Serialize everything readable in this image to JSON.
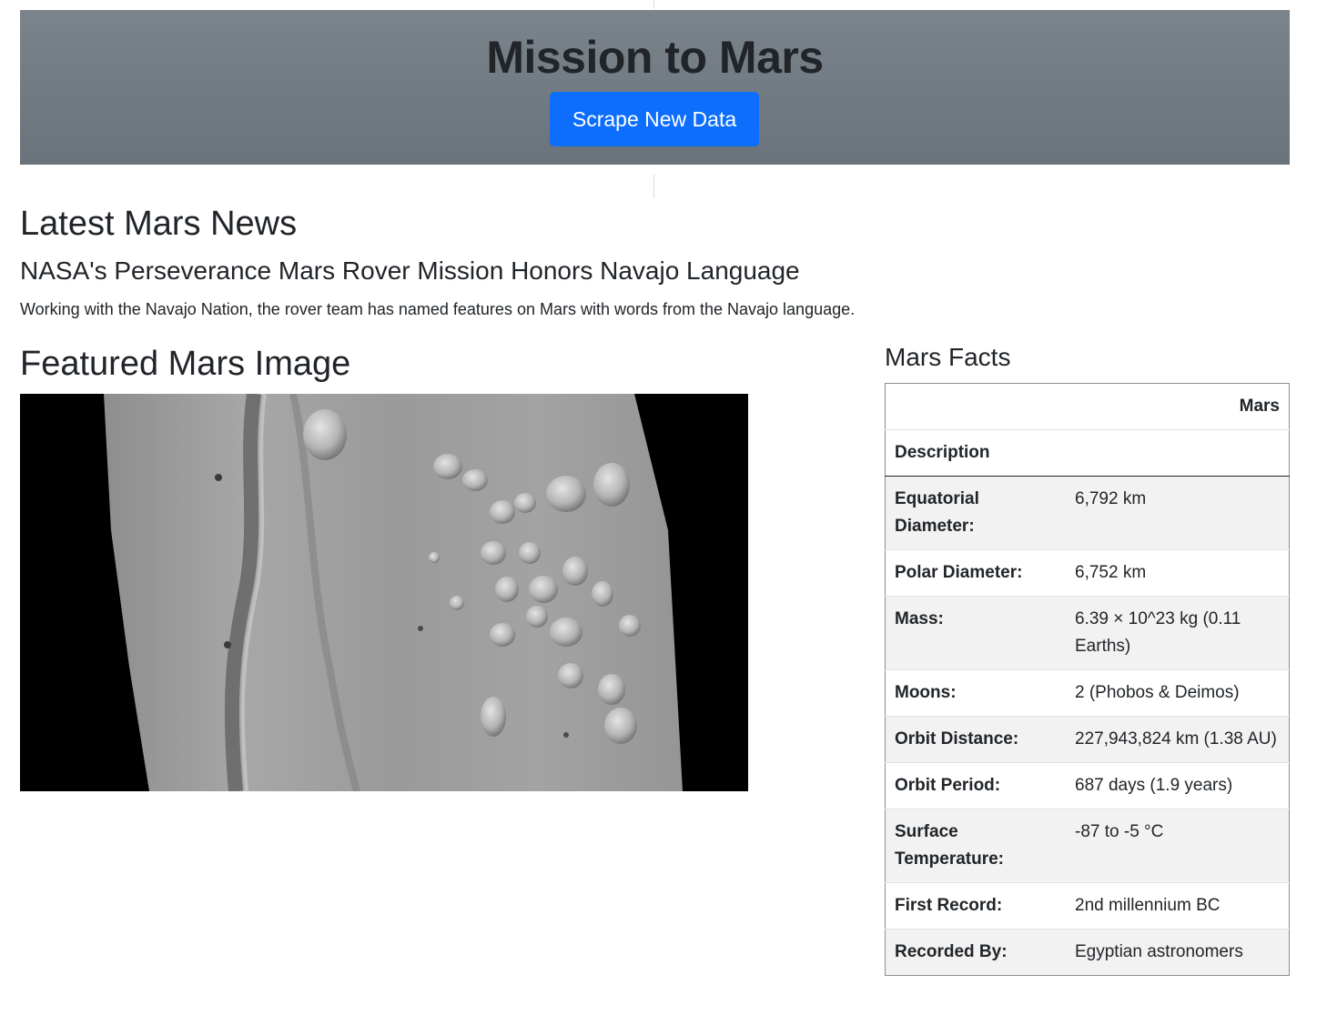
{
  "header": {
    "title": "Mission to Mars",
    "scrape_label": "Scrape New Data",
    "button_color": "#0d6efd",
    "background_color": "#6c757d"
  },
  "news": {
    "section_heading": "Latest Mars News",
    "title": "NASA's Perseverance Mars Rover Mission Honors Navajo Language",
    "paragraph": "Working with the Navajo Nation, the rover team has named features on Mars with words from the Navajo language."
  },
  "featured": {
    "section_heading": "Featured Mars Image",
    "image_alt": "grayscale orbital view of Mars surface with channel and mounds"
  },
  "facts": {
    "section_heading": "Mars Facts",
    "column_header": "Mars",
    "index_header": "Description",
    "rows": [
      {
        "label": "Equatorial Diameter:",
        "value": "6,792 km"
      },
      {
        "label": "Polar Diameter:",
        "value": "6,752 km"
      },
      {
        "label": "Mass:",
        "value": "6.39 × 10^23 kg (0.11 Earths)"
      },
      {
        "label": "Moons:",
        "value": "2 (Phobos & Deimos)"
      },
      {
        "label": "Orbit Distance:",
        "value": "227,943,824 km (1.38 AU)"
      },
      {
        "label": "Orbit Period:",
        "value": "687 days (1.9 years)"
      },
      {
        "label": "Surface Temperature:",
        "value": "-87 to -5 °C"
      },
      {
        "label": "First Record:",
        "value": "2nd millennium BC"
      },
      {
        "label": "Recorded By:",
        "value": "Egyptian astronomers"
      }
    ]
  }
}
